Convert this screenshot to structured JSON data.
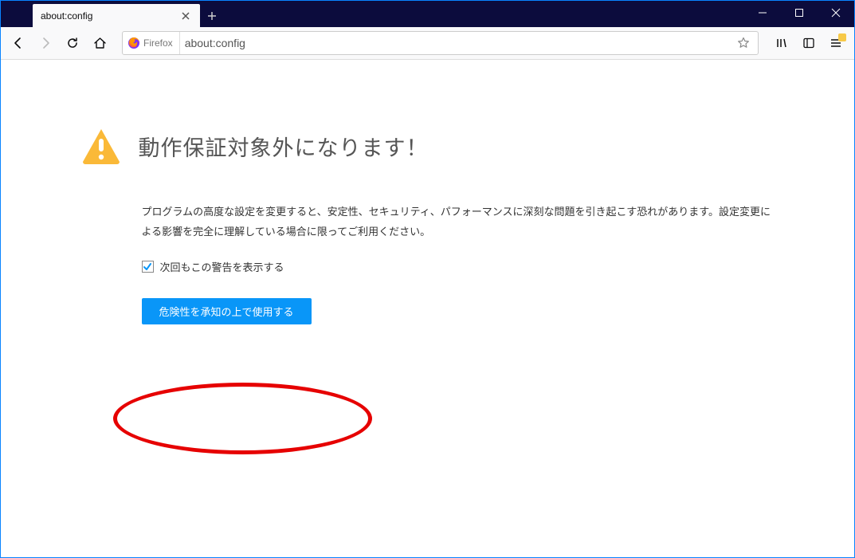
{
  "tab": {
    "title": "about:config"
  },
  "urlbar": {
    "identity_label": "Firefox",
    "url": "about:config"
  },
  "warning": {
    "title": "動作保証対象外になります！",
    "body": "プログラムの高度な設定を変更すると、安定性、セキュリティ、パフォーマンスに深刻な問題を引き起こす恐れがあります。設定変更による影響を完全に理解している場合に限ってご利用ください。",
    "checkbox_label": "次回もこの警告を表示する",
    "checkbox_checked": true,
    "accept_label": "危険性を承知の上で使用する"
  }
}
